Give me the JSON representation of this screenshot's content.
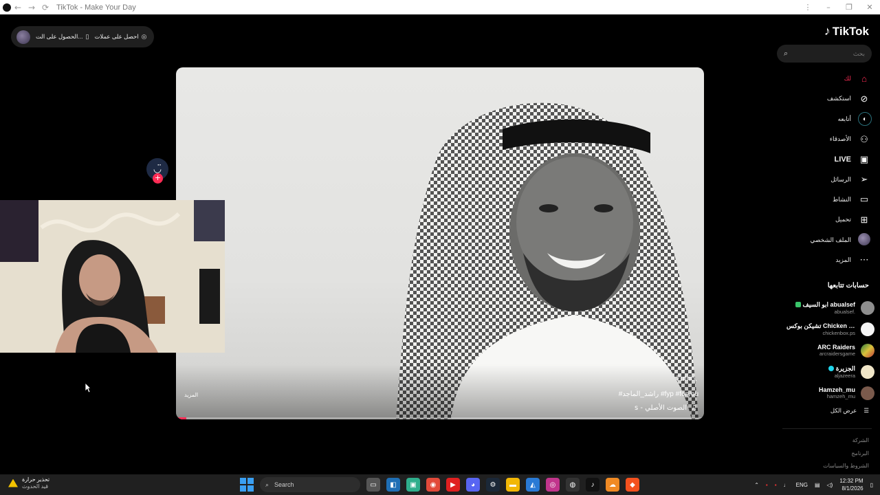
{
  "window": {
    "title": "TikTok - Make Your Day",
    "back": "←",
    "forward": "→",
    "reload": "⟳",
    "more": "⋮",
    "minimize": "–",
    "restore": "❐",
    "close": "✕"
  },
  "top_pill": {
    "item1": "احصل على عملات",
    "item2": "الحصول على الت...",
    "icon1": "coin-icon",
    "icon2": "phone-icon"
  },
  "video": {
    "author": "7utrio.",
    "hashtags": "#راشد_الماجد #fyp #foryou",
    "sound": "s - الصوت الأصلي",
    "more": "المزيد",
    "progress": 0.02
  },
  "actions": {
    "avatar_glyph": "◡̈",
    "plus": "+"
  },
  "sidebar": {
    "logo": "TikTok",
    "search_placeholder": "بحث",
    "nav": [
      {
        "label": "لك",
        "icon": "home-icon"
      },
      {
        "label": "استكشف",
        "icon": "compass-icon"
      },
      {
        "label": "أتابعه",
        "icon": "following-icon"
      },
      {
        "label": "الأصدقاء",
        "icon": "friends-icon"
      },
      {
        "label": "LIVE",
        "icon": "live-icon"
      },
      {
        "label": "الرسائل",
        "icon": "messages-icon"
      },
      {
        "label": "النشاط",
        "icon": "activity-icon"
      },
      {
        "label": "تحميل",
        "icon": "upload-icon"
      },
      {
        "label": "الملف الشخصي",
        "icon": "profile-icon"
      },
      {
        "label": "المزيد",
        "icon": "more-icon"
      }
    ],
    "following_title": "حسابات تتابعها",
    "following": [
      {
        "name": "ابو السيف abualsef",
        "handle": "abualsef."
      },
      {
        "name": "تشيكن بوكس Chicken Box...",
        "handle": "chickenbox.ps"
      },
      {
        "name": "ARC Raiders",
        "handle": "arcraidersgame"
      },
      {
        "name": "الجزيرة",
        "handle": "aljazeera"
      },
      {
        "name": "Hamzeh_mu",
        "handle": "hamzeh_mu"
      }
    ],
    "see_all": "عرض الكل",
    "footer": [
      "الشركة",
      "البرنامج",
      "الشروط والسياسات"
    ]
  },
  "taskbar": {
    "weather_title": "تحذير حرارة",
    "weather_sub": "قيد الحدوث",
    "search": "Search",
    "lang": "ENG",
    "time": "12:32 PM",
    "date": "8/1/2026"
  }
}
